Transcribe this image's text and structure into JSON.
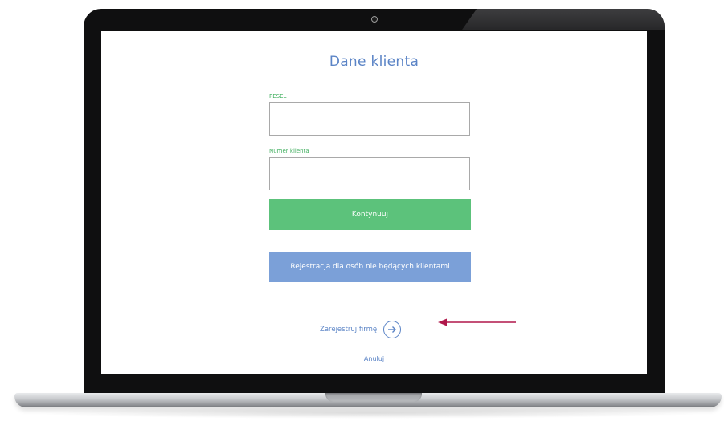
{
  "form": {
    "title": "Dane klienta",
    "pesel_label": "PESEL",
    "pesel_value": "",
    "client_number_label": "Numer klienta",
    "client_number_value": "",
    "continue_label": "Kontynuuj",
    "register_label": "Rejestracja dla osób nie będących klientami",
    "company_link_label": "Zarejestruj firmę",
    "cancel_label": "Anuluj"
  },
  "icons": {
    "company_link_icon": "arrow-right-circle-icon",
    "annotation_icon": "pointer-arrow-icon"
  },
  "colors": {
    "title_blue": "#5b84c6",
    "label_green": "#3fae5e",
    "continue_green": "#5cc27b",
    "register_blue": "#7ba0d8",
    "annotation_red": "#b0174a"
  }
}
